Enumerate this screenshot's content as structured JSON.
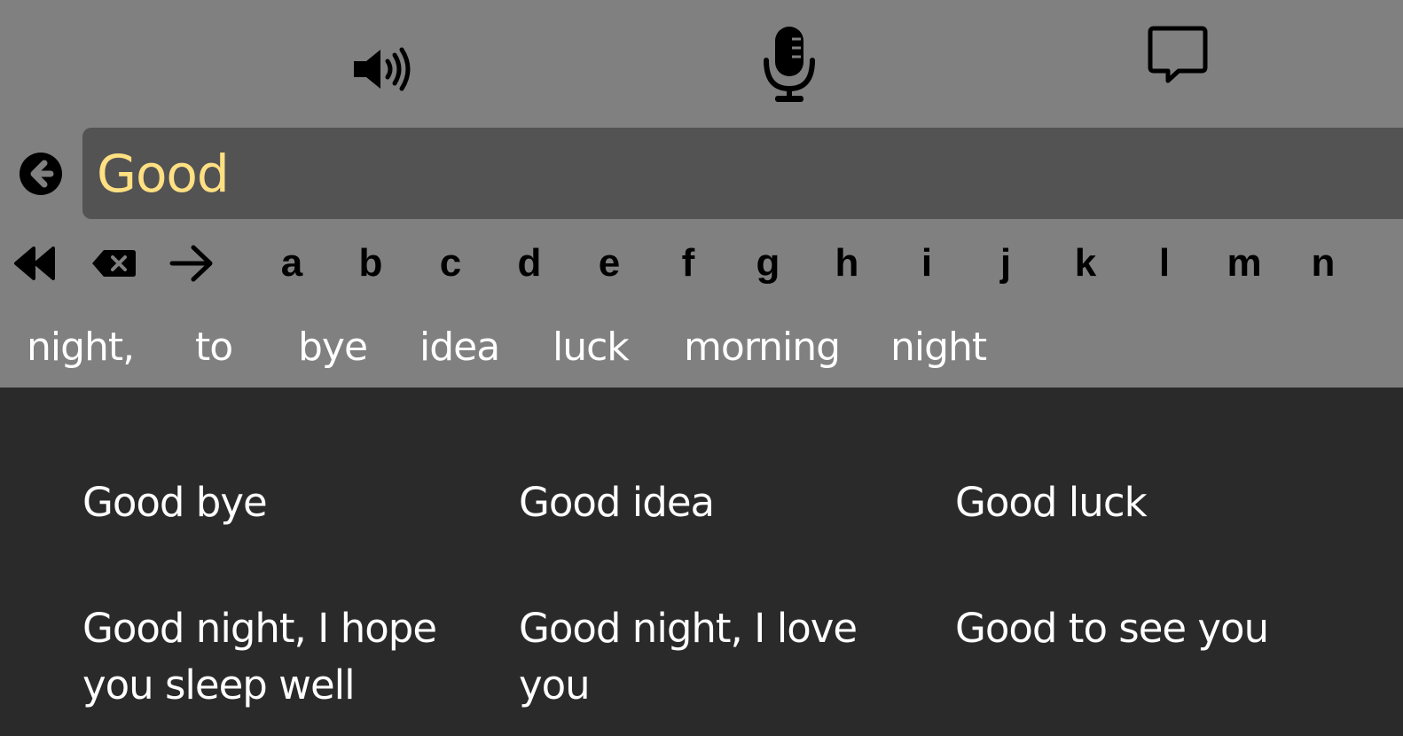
{
  "colors": {
    "topbar_bg": "#808080",
    "panel_bg": "#2a2a2a",
    "field_bg": "#535353",
    "input_text": "#ffe082",
    "text": "#ffffff"
  },
  "icons": [
    "speaker-icon",
    "microphone-icon",
    "chat-bubble-icon",
    "back-icon",
    "rewind-icon",
    "delete-icon",
    "forward-arrow-icon"
  ],
  "input": {
    "value": "Good"
  },
  "keyboard": {
    "letters": [
      "a",
      "b",
      "c",
      "d",
      "e",
      "f",
      "g",
      "h",
      "i",
      "j",
      "k",
      "l",
      "m",
      "n"
    ]
  },
  "suggestions": [
    "night,",
    "to",
    "bye",
    "idea",
    "luck",
    "morning",
    "night"
  ],
  "phrases": [
    "Good bye",
    "Good idea",
    "Good luck",
    "Good night, I hope you sleep well",
    "Good night, I love you",
    "Good to see you"
  ]
}
